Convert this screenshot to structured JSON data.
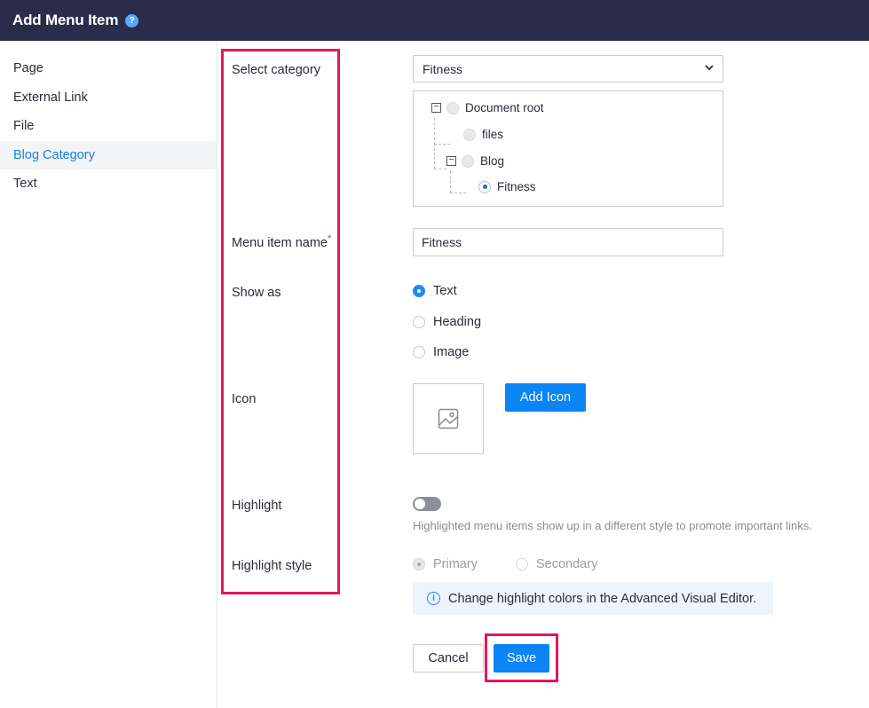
{
  "header": {
    "title": "Add Menu Item",
    "help_icon": "?"
  },
  "sidebar": {
    "items": [
      {
        "label": "Page"
      },
      {
        "label": "External Link"
      },
      {
        "label": "File"
      },
      {
        "label": "Blog Category"
      },
      {
        "label": "Text"
      }
    ],
    "active": "Blog Category"
  },
  "form": {
    "labels": {
      "select_category": "Select category",
      "menu_item_name": "Menu item name",
      "required_mark": "*",
      "show_as": "Show as",
      "icon": "Icon",
      "highlight": "Highlight",
      "highlight_style": "Highlight style"
    },
    "category_select": {
      "value": "Fitness"
    },
    "tree": {
      "root": "Document root",
      "files": "files",
      "blog": "Blog",
      "fitness": "Fitness",
      "collapse_symbol": "−"
    },
    "menu_item_name_value": "Fitness",
    "show_as_options": {
      "text": "Text",
      "heading": "Heading",
      "image": "Image",
      "selected": "Text"
    },
    "add_icon_label": "Add Icon",
    "highlight_enabled": false,
    "highlight_hint": "Highlighted menu items show up in a different style to promote important links.",
    "highlight_style_options": {
      "primary": "Primary",
      "secondary": "Secondary",
      "selected": "Primary"
    },
    "info_icon": "i",
    "info_text": "Change highlight colors in the Advanced Visual Editor.",
    "cancel_label": "Cancel",
    "save_label": "Save"
  },
  "colors": {
    "header_bg": "#2a2d4a",
    "accent": "#0b84f6",
    "annotation": "#e8155e"
  }
}
